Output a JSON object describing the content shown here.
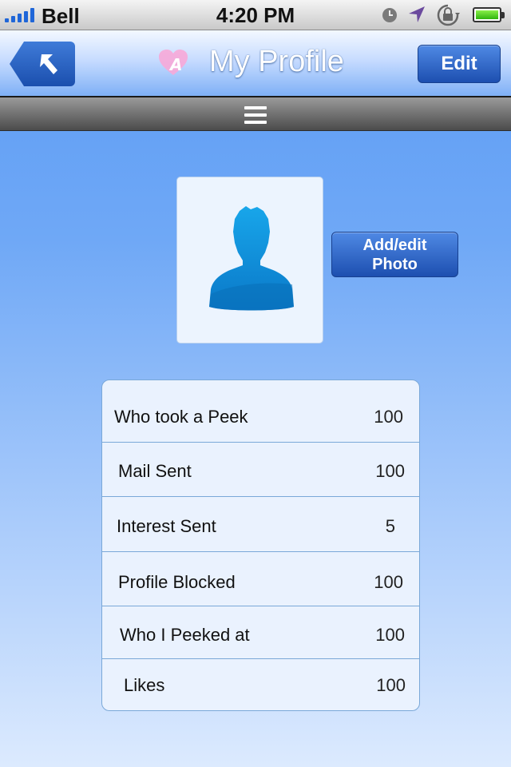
{
  "status_bar": {
    "carrier": "Bell",
    "time": "4:20 PM"
  },
  "nav": {
    "title": "My Profile",
    "edit_label": "Edit",
    "back_icon": "back-arrow-icon",
    "logo_icon": "heart-logo-icon"
  },
  "menu": {
    "icon": "hamburger-menu-icon"
  },
  "photo": {
    "button_line1": "Add/edit",
    "button_line2": "Photo",
    "placeholder_icon": "person-silhouette-icon"
  },
  "stats": [
    {
      "label": "Who took a Peek",
      "value": "100"
    },
    {
      "label": "Mail Sent",
      "value": "100"
    },
    {
      "label": "Interest Sent",
      "value": "5"
    },
    {
      "label": "Profile Blocked",
      "value": "100"
    },
    {
      "label": "Who I Peeked at",
      "value": "100"
    },
    {
      "label": "Likes",
      "value": "100"
    }
  ],
  "colors": {
    "accent_button": "#1d4fb0",
    "background_top": "#5b9bf4",
    "background_bottom": "#dceafe",
    "avatar": "#1a9fe6"
  }
}
